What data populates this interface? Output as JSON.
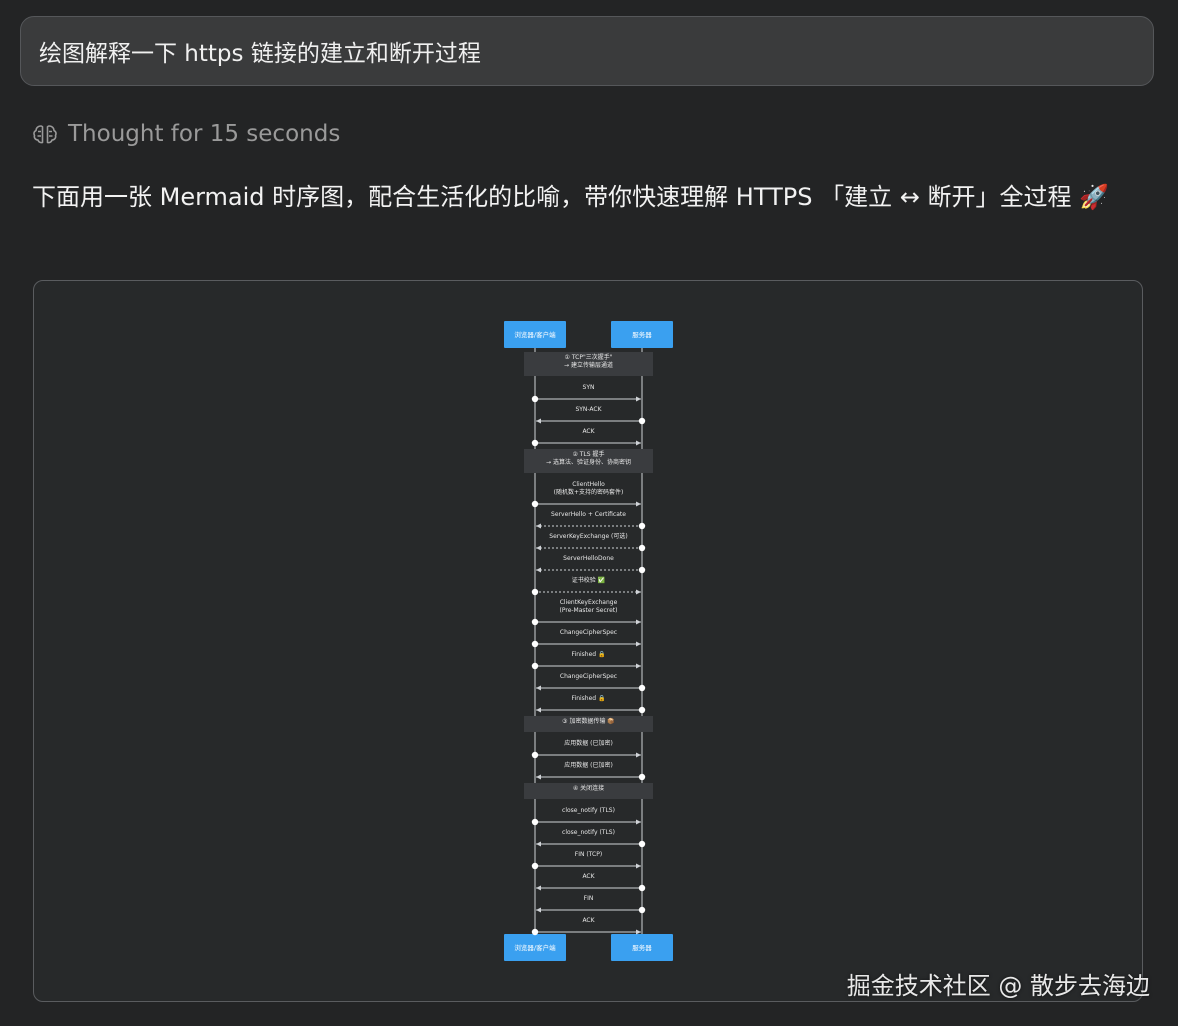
{
  "prompt": {
    "text": "绘图解释一下 https 链接的建立和断开过程"
  },
  "thought": {
    "label": "Thought for 15 seconds",
    "icon": "brain-icon"
  },
  "answer": {
    "text": "下面用一张 Mermaid 时序图，配合生活化的比喻，带你快速理解 HTTPS 「建立 ↔ 断开」全过程 🚀"
  },
  "diagram": {
    "actor_left": "浏览器/客户端",
    "actor_right": "服务器",
    "colors": {
      "actor": "#3aa0f0",
      "note": "#3a3c3f",
      "line": "#cfd2d6",
      "text": "#e8e8e8",
      "bg": "#27292a"
    },
    "events": [
      {
        "type": "note",
        "lines": [
          "① TCP\"三次握手\"",
          "→ 建立传输层通道"
        ]
      },
      {
        "type": "msg",
        "label": "SYN",
        "dir": "r",
        "style": "solid"
      },
      {
        "type": "msg",
        "label": "SYN-ACK",
        "dir": "l",
        "style": "solid"
      },
      {
        "type": "msg",
        "label": "ACK",
        "dir": "r",
        "style": "solid"
      },
      {
        "type": "note",
        "lines": [
          "② TLS 握手",
          "→ 选算法、验证身份、协商密钥"
        ]
      },
      {
        "type": "msg",
        "label": "ClientHello\n(随机数+支持的密码套件)",
        "dir": "r",
        "style": "solid"
      },
      {
        "type": "msg",
        "label": "ServerHello + Certificate",
        "dir": "l",
        "style": "dashed"
      },
      {
        "type": "msg",
        "label": "ServerKeyExchange (可选)",
        "dir": "l",
        "style": "dashed"
      },
      {
        "type": "msg",
        "label": "ServerHelloDone",
        "dir": "l",
        "style": "dashed"
      },
      {
        "type": "msg",
        "label": "证书校验 ✅",
        "dir": "r",
        "style": "dashed"
      },
      {
        "type": "msg",
        "label": "ClientKeyExchange\n(Pre-Master Secret)",
        "dir": "r",
        "style": "solid"
      },
      {
        "type": "msg",
        "label": "ChangeCipherSpec",
        "dir": "r",
        "style": "solid"
      },
      {
        "type": "msg",
        "label": "Finished 🔒",
        "dir": "r",
        "style": "solid"
      },
      {
        "type": "msg",
        "label": "ChangeCipherSpec",
        "dir": "l",
        "style": "solid"
      },
      {
        "type": "msg",
        "label": "Finished 🔒",
        "dir": "l",
        "style": "solid"
      },
      {
        "type": "note",
        "lines": [
          "③ 加密数据传输 📦"
        ]
      },
      {
        "type": "msg",
        "label": "应用数据 (已加密)",
        "dir": "r",
        "style": "solid"
      },
      {
        "type": "msg",
        "label": "应用数据 (已加密)",
        "dir": "l",
        "style": "solid"
      },
      {
        "type": "note",
        "lines": [
          "④ 关闭连接"
        ]
      },
      {
        "type": "msg",
        "label": "close_notify (TLS)",
        "dir": "r",
        "style": "solid"
      },
      {
        "type": "msg",
        "label": "close_notify (TLS)",
        "dir": "l",
        "style": "solid"
      },
      {
        "type": "msg",
        "label": "FIN (TCP)",
        "dir": "r",
        "style": "solid"
      },
      {
        "type": "msg",
        "label": "ACK",
        "dir": "l",
        "style": "solid"
      },
      {
        "type": "msg",
        "label": "FIN",
        "dir": "l",
        "style": "solid"
      },
      {
        "type": "msg",
        "label": "ACK",
        "dir": "r",
        "style": "solid"
      }
    ]
  },
  "watermark": {
    "text": "掘金技术社区 @ 散步去海边"
  }
}
